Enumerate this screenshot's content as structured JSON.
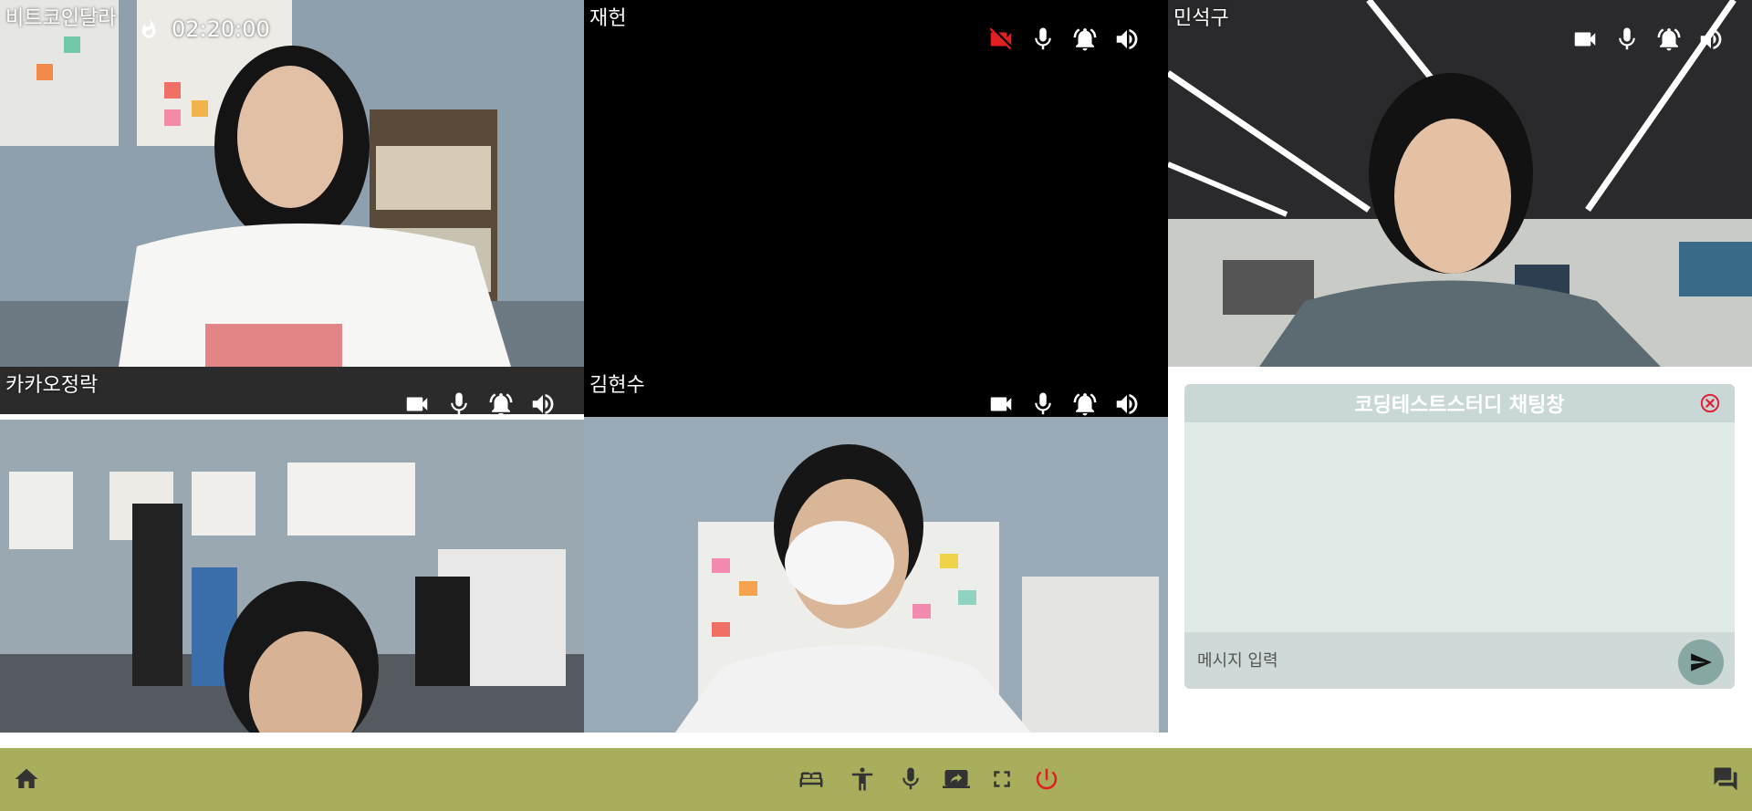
{
  "session": {
    "timer": "02:20:00"
  },
  "tiles": [
    {
      "name": "비트코인달라",
      "camera_on": true
    },
    {
      "name": "재헌",
      "camera_on": false
    },
    {
      "name": "민석구",
      "camera_on": true
    },
    {
      "name": "카카오정락",
      "camera_on": true
    },
    {
      "name": "김현수",
      "camera_on": true
    }
  ],
  "chat": {
    "title": "코딩테스트스터디 채팅창",
    "input_placeholder": "메시지 입력"
  },
  "toolbar": {
    "icons": [
      "home-icon",
      "bed-icon",
      "accessibility-icon",
      "mic-icon",
      "screen-share-icon",
      "fullscreen-icon",
      "power-icon",
      "chat-icon"
    ]
  },
  "colors": {
    "toolbar_bg": "#a9ae5c",
    "power_red": "#e02020",
    "camera_off_red": "#e02020",
    "chat_bg": "#e0ebe8",
    "chat_header": "#c9d8d6",
    "send_button": "#87a8a2"
  }
}
